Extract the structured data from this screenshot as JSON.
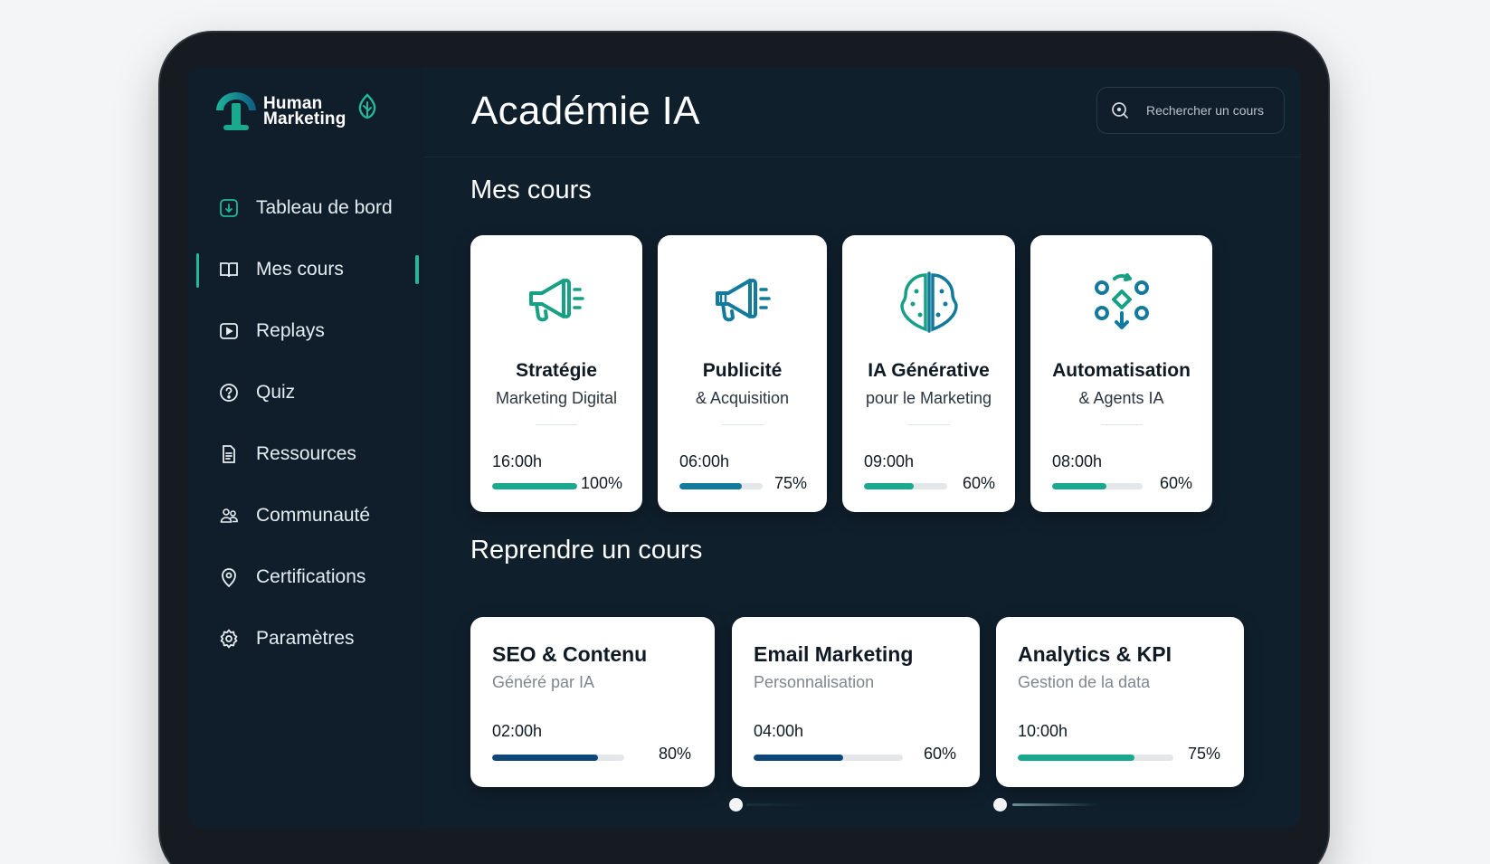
{
  "brand": {
    "line1": "Human",
    "line2": "Marketing",
    "accent": "#22b89a",
    "navy": "#0f5a85"
  },
  "sidebar": {
    "items": [
      {
        "label": "Tableau de bord",
        "icon": "dashboard-icon"
      },
      {
        "label": "Mes cours",
        "icon": "book-icon",
        "active": true
      },
      {
        "label": "Replays",
        "icon": "play-icon"
      },
      {
        "label": "Quiz",
        "icon": "question-icon"
      },
      {
        "label": "Ressources",
        "icon": "document-icon"
      },
      {
        "label": "Communauté",
        "icon": "community-icon"
      },
      {
        "label": "Certifications",
        "icon": "badge-icon"
      },
      {
        "label": "Paramètres",
        "icon": "settings-icon"
      }
    ]
  },
  "header": {
    "title": "Académie IA",
    "search_placeholder": "Rechercher un cours"
  },
  "sections": {
    "courses": "Mes cours",
    "resume": "Reprendre un cours"
  },
  "courses": [
    {
      "title": "Stratégie",
      "subtitle": "Marketing Digital",
      "duration": "16:00h",
      "percent": "100%",
      "progress": 1.0,
      "color": "#1aa88e",
      "icon": "megaphone-icon"
    },
    {
      "title": "Publicité",
      "subtitle": "& Acquisition",
      "duration": "06:00h",
      "percent": "75%",
      "progress": 0.75,
      "color": "#137a9c",
      "icon": "megaphone-icon"
    },
    {
      "title": "IA Générative",
      "subtitle": "pour le Marketing",
      "duration": "09:00h",
      "percent": "60%",
      "progress": 0.6,
      "color": "#1aa88e",
      "icon": "brain-icon"
    },
    {
      "title": "Automatisation",
      "subtitle": "& Agents IA",
      "duration": "08:00h",
      "percent": "60%",
      "progress": 0.6,
      "color": "#1aa88e",
      "icon": "automation-icon"
    }
  ],
  "resume": [
    {
      "title": "SEO & Contenu",
      "subtitle": "Généré par IA",
      "duration": "02:00h",
      "percent": "80%",
      "progress": 0.8,
      "color": "#10477a"
    },
    {
      "title": "Email Marketing",
      "subtitle": "Personnalisation",
      "duration": "04:00h",
      "percent": "60%",
      "progress": 0.6,
      "color": "#10477a"
    },
    {
      "title": "Analytics & KPI",
      "subtitle": "Gestion de la data",
      "duration": "10:00h",
      "percent": "75%",
      "progress": 0.75,
      "color": "#1aa88e"
    }
  ]
}
